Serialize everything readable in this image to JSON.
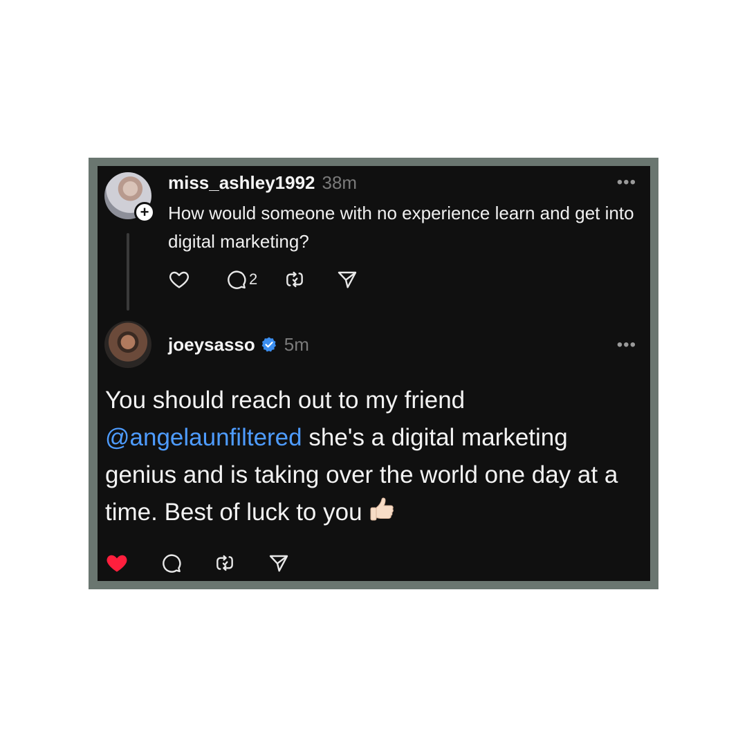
{
  "post1": {
    "username": "miss_ashley1992",
    "time": "38m",
    "text": "How would someone with no experience learn and get into digital marketing?",
    "reply_count": "2",
    "more": "•••"
  },
  "post2": {
    "username": "joeysasso",
    "time": "5m",
    "text_before": "You should reach out to my friend ",
    "mention": "@angelaunfiltered",
    "text_after": " she's a digital marketing genius and is taking over the world one day at a time. Best of luck to you",
    "more": "•••",
    "liked": true
  },
  "colors": {
    "frame": "#6a7670",
    "card": "#101010",
    "mention": "#4e9cff",
    "verified": "#3b8ef0",
    "heart_liked": "#ff1f3d"
  },
  "icons": [
    "plus-icon",
    "heart-icon",
    "comment-icon",
    "repost-icon",
    "share-icon",
    "verified-icon",
    "more-icon",
    "thumbs-up-emoji"
  ]
}
